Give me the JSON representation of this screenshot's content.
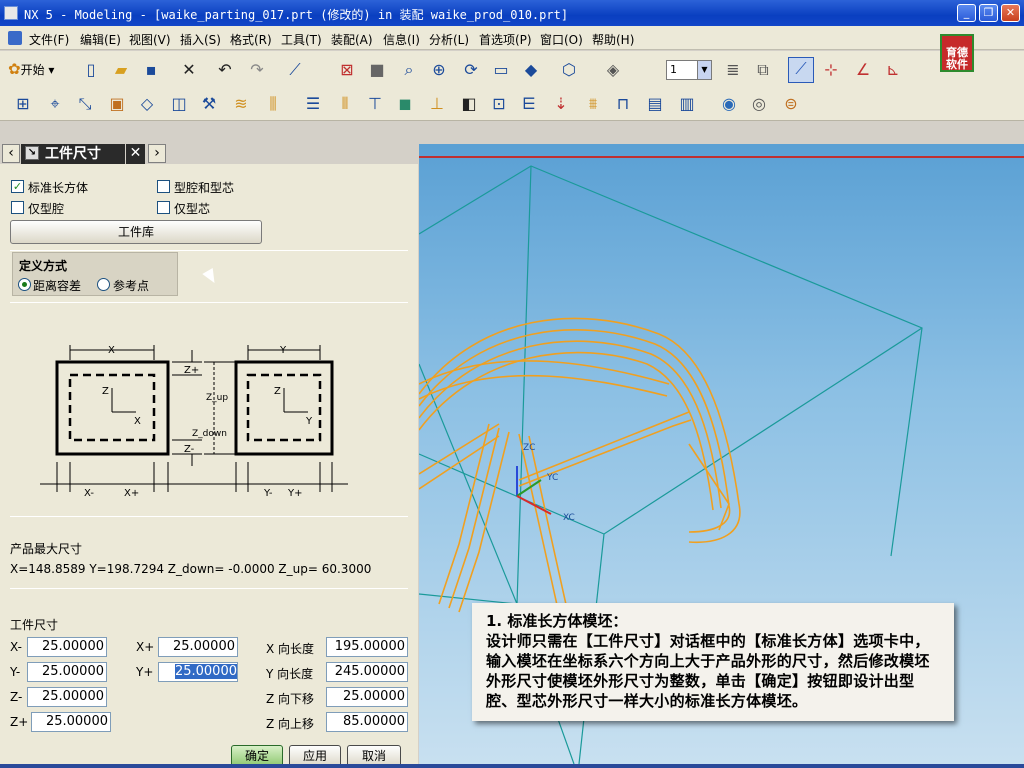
{
  "window": {
    "title": "NX 5 - Modeling - [waike_parting_017.prt  (修改的)   in 装配 waike_prod_010.prt]",
    "controls": [
      "_",
      "❐",
      "✕"
    ]
  },
  "menubar": {
    "items": [
      "文件(F)",
      "编辑(E)",
      "视图(V)",
      "插入(S)",
      "格式(R)",
      "工具(T)",
      "装配(A)",
      "信息(I)",
      "分析(L)",
      "首选项(P)",
      "窗口(O)",
      "帮助(H)"
    ],
    "logo": "育德软件"
  },
  "toolbar": {
    "start_label": "开始",
    "layer_value": "1"
  },
  "panel": {
    "tab_title": "工件尺寸",
    "options": {
      "std_block": "标准长方体",
      "cavity_core": "型腔和型芯",
      "cavity_only": "仅型腔",
      "core_only": "仅型芯"
    },
    "library_button": "工件库",
    "define_method": {
      "title": "定义方式",
      "distance_tolerance": "距离容差",
      "reference_point": "参考点"
    },
    "product_max_size": {
      "title": "产品最大尺寸",
      "value": "X=148.8589  Y=198.7294  Z_down= -0.0000  Z_up= 60.3000"
    },
    "block_size": {
      "title": "工件尺寸",
      "x_minus_label": "X-",
      "x_minus": "25.00000",
      "x_plus_label": "X+",
      "x_plus": "25.00000",
      "y_minus_label": "Y-",
      "y_minus": "25.00000",
      "y_plus_label": "Y+",
      "y_plus": "25.00000",
      "z_minus_label": "Z-",
      "z_minus": "25.00000",
      "z_plus_label": "Z+",
      "z_plus": "25.00000",
      "x_len_label": "X 向长度",
      "x_len": "195.00000",
      "y_len_label": "Y 向长度",
      "y_len": "245.00000",
      "z_down_label": "Z 向下移",
      "z_down": "25.00000",
      "z_up_label": "Z 向上移",
      "z_up": "85.00000"
    },
    "buttons": {
      "ok": "确定",
      "apply": "应用",
      "cancel": "取消"
    }
  },
  "diagram": {
    "labels": [
      "X",
      "Y",
      "Z+",
      "Z-",
      "Z_up",
      "Z_down",
      "X-",
      "X+",
      "Y-",
      "Y+",
      "Z",
      "X",
      "Z",
      "Y"
    ]
  },
  "viewport": {
    "axis_labels": [
      "ZC",
      "YC",
      "XC"
    ]
  },
  "callout": {
    "title": "1.  标准长方体模坯：",
    "text": "设计师只需在【工件尺寸】对话框中的【标准长方体】选项卡中，输入模坯在坐标系六个方向上大于产品外形的尺寸，然后修改模坯外形尺寸使模坯外形尺寸为整数，单击【确定】按钮即设计出型腔、型芯外形尺寸一样大小的标准长方体模坯。"
  }
}
